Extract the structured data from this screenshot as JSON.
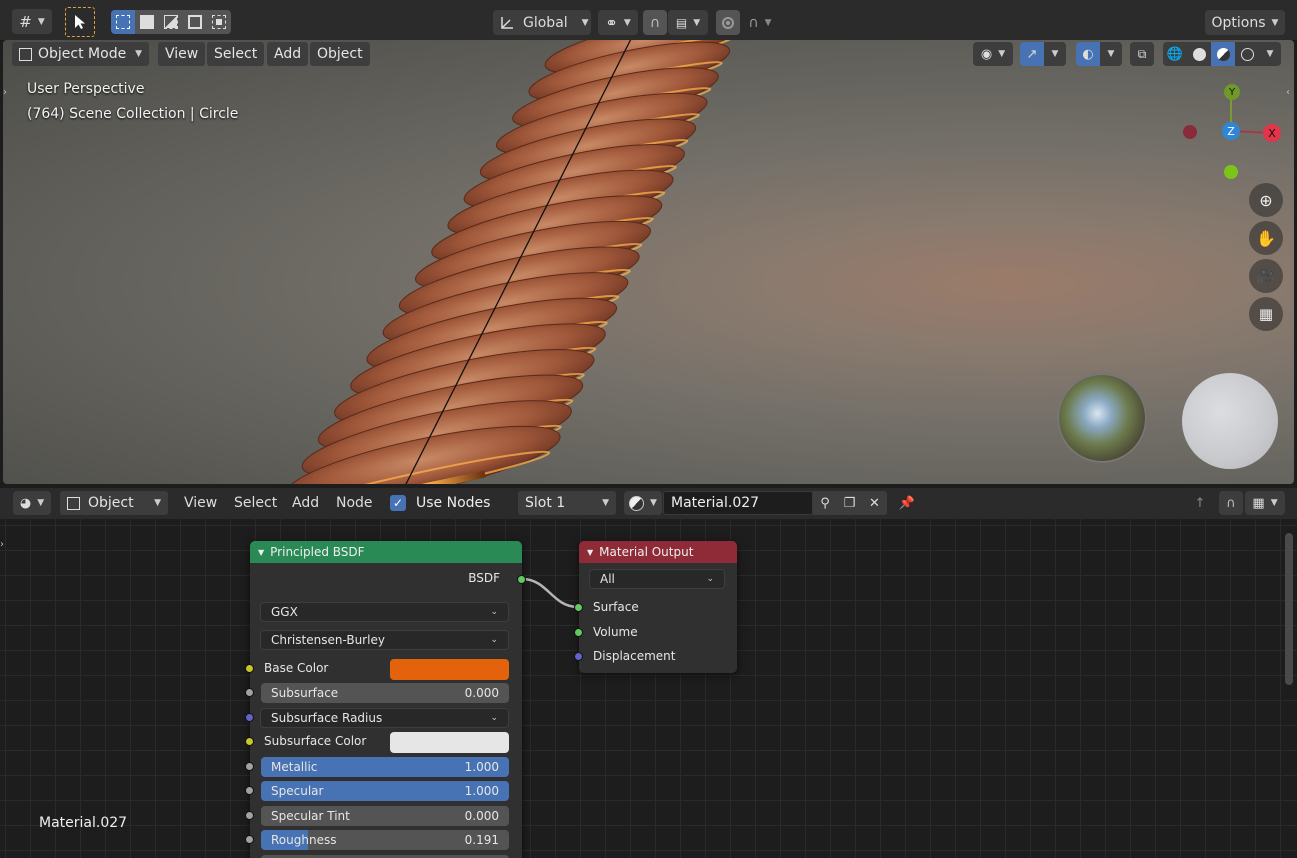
{
  "top_header": {
    "transform_orientation": "Global",
    "options_label": "Options"
  },
  "viewport_header": {
    "mode": "Object Mode",
    "menus": [
      "View",
      "Select",
      "Add",
      "Object"
    ]
  },
  "viewport": {
    "perspective": "User Perspective",
    "collection_info": "(764) Scene Collection | Circle",
    "gizmo_axes": {
      "y": "Y",
      "z": "Z",
      "x": "X"
    }
  },
  "node_header": {
    "object_type": "Object",
    "menus": [
      "View",
      "Select",
      "Add",
      "Node"
    ],
    "use_nodes_label": "Use Nodes",
    "slot": "Slot 1",
    "material_name": "Material.027"
  },
  "node_area": {
    "material_label": "Material.027"
  },
  "bsdf_node": {
    "title": "Principled BSDF",
    "output_label": "BSDF",
    "distribution": "GGX",
    "subsurface_method": "Christensen-Burley",
    "base_color_label": "Base Color",
    "base_color": "#e3630c",
    "subsurface": {
      "label": "Subsurface",
      "value": "0.000"
    },
    "subsurface_radius_label": "Subsurface Radius",
    "subsurface_color_label": "Subsurface Color",
    "subsurface_color": "#e6e6e6",
    "metallic": {
      "label": "Metallic",
      "value": "1.000"
    },
    "specular": {
      "label": "Specular",
      "value": "1.000"
    },
    "specular_tint": {
      "label": "Specular Tint",
      "value": "0.000"
    },
    "roughness": {
      "label": "Roughness",
      "value": "0.191",
      "fraction": 0.191
    }
  },
  "output_node": {
    "title": "Material Output",
    "target": "All",
    "inputs": [
      "Surface",
      "Volume",
      "Displacement"
    ]
  },
  "colors": {
    "accent": "#4772b3",
    "bsdf_header": "#2a8a55",
    "output_header": "#8f2b36"
  }
}
